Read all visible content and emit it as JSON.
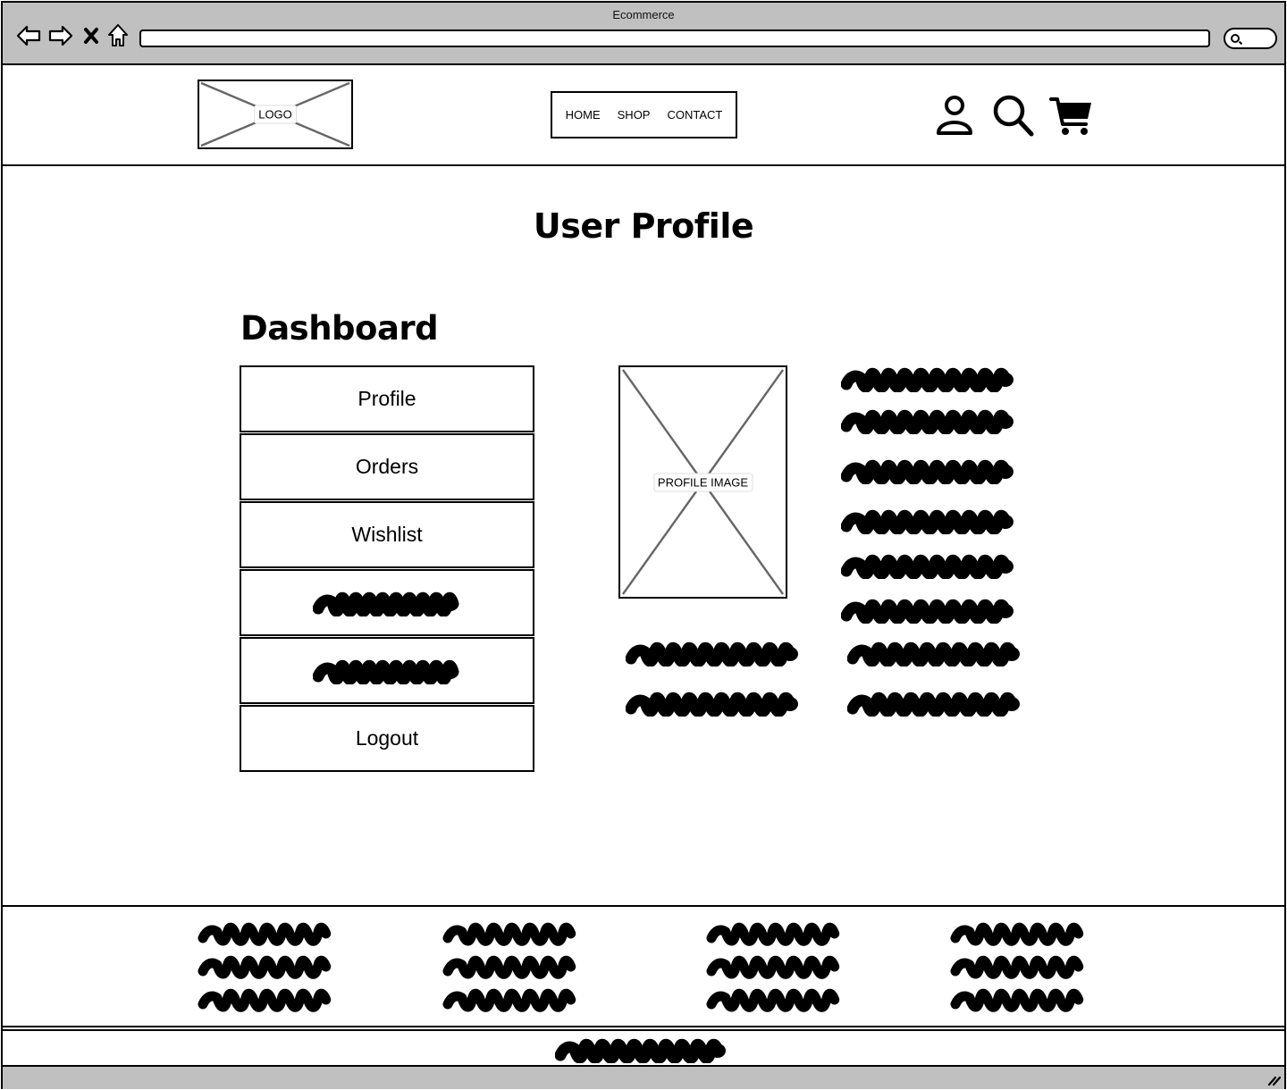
{
  "browser": {
    "title": "Ecommerce",
    "back_icon": "arrow-left-icon",
    "forward_icon": "arrow-right-icon",
    "stop_icon": "close-icon",
    "home_icon": "home-icon",
    "address_value": "",
    "search_icon": "search-icon"
  },
  "header": {
    "logo_label": "LOGO",
    "nav": [
      {
        "label": "HOME"
      },
      {
        "label": "SHOP"
      },
      {
        "label": "CONTACT"
      }
    ],
    "icons": [
      "user-icon",
      "search-icon",
      "cart-icon"
    ]
  },
  "main": {
    "page_title": "User Profile",
    "dashboard_title": "Dashboard",
    "menu": [
      {
        "label": "Profile",
        "placeholder": false
      },
      {
        "label": "Orders",
        "placeholder": false
      },
      {
        "label": "Wishlist",
        "placeholder": false
      },
      {
        "label": "",
        "placeholder": true
      },
      {
        "label": "",
        "placeholder": true
      },
      {
        "label": "Logout",
        "placeholder": false
      }
    ],
    "profile_image_label": "PROFILE IMAGE",
    "profile_info_lines": 6,
    "profile_detail_rows": 2,
    "profile_detail_cols": 2
  },
  "footer": {
    "columns": 4,
    "lines_per_column": 3,
    "copyright_placeholder": true
  },
  "colors": {
    "chrome": "#c0c0c0",
    "border": "#000000",
    "placeholder_line": "#666666"
  }
}
